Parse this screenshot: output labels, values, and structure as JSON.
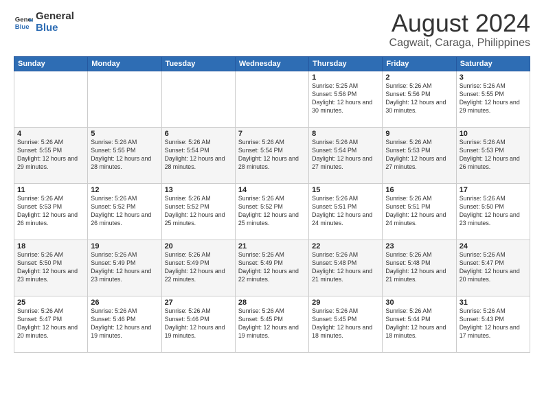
{
  "logo": {
    "line1": "General",
    "line2": "Blue"
  },
  "title": "August 2024",
  "subtitle": "Cagwait, Caraga, Philippines",
  "days_header": [
    "Sunday",
    "Monday",
    "Tuesday",
    "Wednesday",
    "Thursday",
    "Friday",
    "Saturday"
  ],
  "weeks": [
    [
      {
        "day": "",
        "info": ""
      },
      {
        "day": "",
        "info": ""
      },
      {
        "day": "",
        "info": ""
      },
      {
        "day": "",
        "info": ""
      },
      {
        "day": "1",
        "info": "Sunrise: 5:25 AM\nSunset: 5:56 PM\nDaylight: 12 hours\nand 30 minutes."
      },
      {
        "day": "2",
        "info": "Sunrise: 5:26 AM\nSunset: 5:56 PM\nDaylight: 12 hours\nand 30 minutes."
      },
      {
        "day": "3",
        "info": "Sunrise: 5:26 AM\nSunset: 5:55 PM\nDaylight: 12 hours\nand 29 minutes."
      }
    ],
    [
      {
        "day": "4",
        "info": "Sunrise: 5:26 AM\nSunset: 5:55 PM\nDaylight: 12 hours\nand 29 minutes."
      },
      {
        "day": "5",
        "info": "Sunrise: 5:26 AM\nSunset: 5:55 PM\nDaylight: 12 hours\nand 28 minutes."
      },
      {
        "day": "6",
        "info": "Sunrise: 5:26 AM\nSunset: 5:54 PM\nDaylight: 12 hours\nand 28 minutes."
      },
      {
        "day": "7",
        "info": "Sunrise: 5:26 AM\nSunset: 5:54 PM\nDaylight: 12 hours\nand 28 minutes."
      },
      {
        "day": "8",
        "info": "Sunrise: 5:26 AM\nSunset: 5:54 PM\nDaylight: 12 hours\nand 27 minutes."
      },
      {
        "day": "9",
        "info": "Sunrise: 5:26 AM\nSunset: 5:53 PM\nDaylight: 12 hours\nand 27 minutes."
      },
      {
        "day": "10",
        "info": "Sunrise: 5:26 AM\nSunset: 5:53 PM\nDaylight: 12 hours\nand 26 minutes."
      }
    ],
    [
      {
        "day": "11",
        "info": "Sunrise: 5:26 AM\nSunset: 5:53 PM\nDaylight: 12 hours\nand 26 minutes."
      },
      {
        "day": "12",
        "info": "Sunrise: 5:26 AM\nSunset: 5:52 PM\nDaylight: 12 hours\nand 26 minutes."
      },
      {
        "day": "13",
        "info": "Sunrise: 5:26 AM\nSunset: 5:52 PM\nDaylight: 12 hours\nand 25 minutes."
      },
      {
        "day": "14",
        "info": "Sunrise: 5:26 AM\nSunset: 5:52 PM\nDaylight: 12 hours\nand 25 minutes."
      },
      {
        "day": "15",
        "info": "Sunrise: 5:26 AM\nSunset: 5:51 PM\nDaylight: 12 hours\nand 24 minutes."
      },
      {
        "day": "16",
        "info": "Sunrise: 5:26 AM\nSunset: 5:51 PM\nDaylight: 12 hours\nand 24 minutes."
      },
      {
        "day": "17",
        "info": "Sunrise: 5:26 AM\nSunset: 5:50 PM\nDaylight: 12 hours\nand 23 minutes."
      }
    ],
    [
      {
        "day": "18",
        "info": "Sunrise: 5:26 AM\nSunset: 5:50 PM\nDaylight: 12 hours\nand 23 minutes."
      },
      {
        "day": "19",
        "info": "Sunrise: 5:26 AM\nSunset: 5:49 PM\nDaylight: 12 hours\nand 23 minutes."
      },
      {
        "day": "20",
        "info": "Sunrise: 5:26 AM\nSunset: 5:49 PM\nDaylight: 12 hours\nand 22 minutes."
      },
      {
        "day": "21",
        "info": "Sunrise: 5:26 AM\nSunset: 5:49 PM\nDaylight: 12 hours\nand 22 minutes."
      },
      {
        "day": "22",
        "info": "Sunrise: 5:26 AM\nSunset: 5:48 PM\nDaylight: 12 hours\nand 21 minutes."
      },
      {
        "day": "23",
        "info": "Sunrise: 5:26 AM\nSunset: 5:48 PM\nDaylight: 12 hours\nand 21 minutes."
      },
      {
        "day": "24",
        "info": "Sunrise: 5:26 AM\nSunset: 5:47 PM\nDaylight: 12 hours\nand 20 minutes."
      }
    ],
    [
      {
        "day": "25",
        "info": "Sunrise: 5:26 AM\nSunset: 5:47 PM\nDaylight: 12 hours\nand 20 minutes."
      },
      {
        "day": "26",
        "info": "Sunrise: 5:26 AM\nSunset: 5:46 PM\nDaylight: 12 hours\nand 19 minutes."
      },
      {
        "day": "27",
        "info": "Sunrise: 5:26 AM\nSunset: 5:46 PM\nDaylight: 12 hours\nand 19 minutes."
      },
      {
        "day": "28",
        "info": "Sunrise: 5:26 AM\nSunset: 5:45 PM\nDaylight: 12 hours\nand 19 minutes."
      },
      {
        "day": "29",
        "info": "Sunrise: 5:26 AM\nSunset: 5:45 PM\nDaylight: 12 hours\nand 18 minutes."
      },
      {
        "day": "30",
        "info": "Sunrise: 5:26 AM\nSunset: 5:44 PM\nDaylight: 12 hours\nand 18 minutes."
      },
      {
        "day": "31",
        "info": "Sunrise: 5:26 AM\nSunset: 5:43 PM\nDaylight: 12 hours\nand 17 minutes."
      }
    ]
  ]
}
